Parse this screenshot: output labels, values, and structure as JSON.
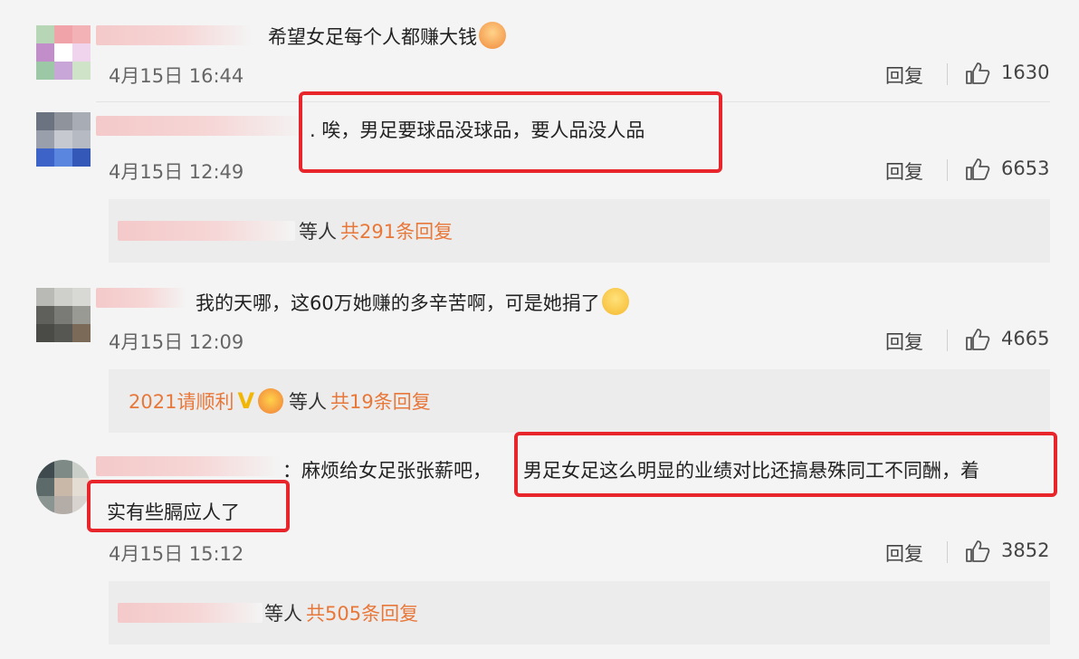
{
  "colors": {
    "accent": "#e8773a",
    "highlight": "#e8252b",
    "background": "#f4f4f4"
  },
  "comments": [
    {
      "text": "希望女足每个人都赚大钱",
      "time": "4月15日 16:44",
      "reply": "回复",
      "likes": "1630",
      "emoji": "fire-hug-emoji"
    },
    {
      "text": ". 唉，男足要球品没球品，要人品没人品",
      "time": "4月15日 12:49",
      "reply": "回复",
      "likes": "6653",
      "replies": {
        "suffix": "等人",
        "count": "共291条回复"
      }
    },
    {
      "text": "我的天哪，这60万她赚的多辛苦啊，可是她捐了",
      "time": "4月15日 12:09",
      "reply": "回复",
      "likes": "4665",
      "emoji": "crying-emoji",
      "replies": {
        "user": "2021请顺利",
        "suffix": "等人",
        "count": "共19条回复"
      }
    },
    {
      "text_a": "：麻烦给女足张张薪吧，",
      "text_b": "男足女足这么明显的业绩对比还搞悬殊同工不同酬，着",
      "text_c": "实有些膈应人了",
      "time": "4月15日 15:12",
      "reply": "回复",
      "likes": "3852",
      "replies": {
        "suffix": "等人",
        "count": "共505条回复"
      }
    }
  ]
}
